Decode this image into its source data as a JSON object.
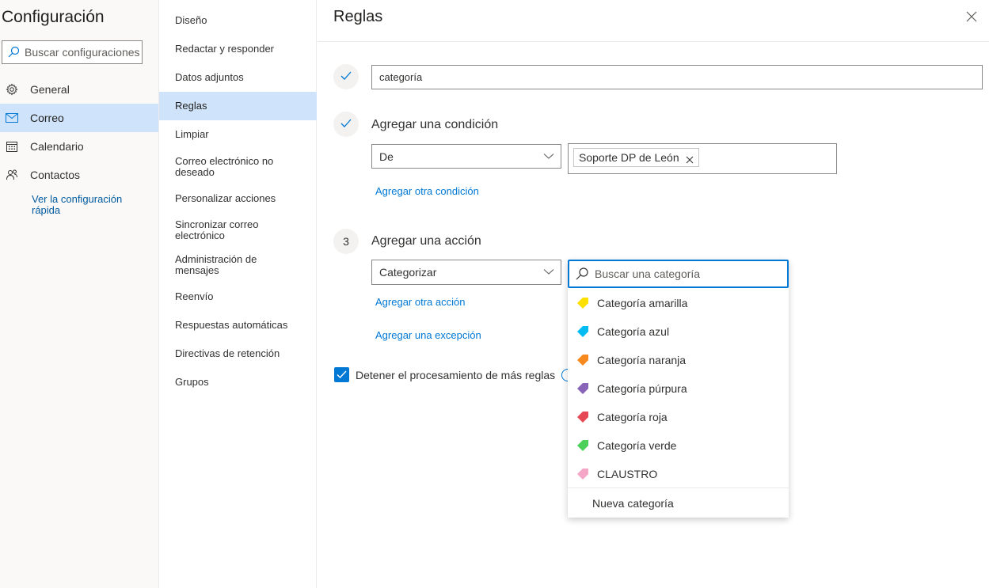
{
  "app": {
    "title": "Configuración",
    "search_placeholder": "Buscar configuraciones"
  },
  "left_nav": {
    "items": [
      {
        "label": "General",
        "icon": "gear-icon"
      },
      {
        "label": "Correo",
        "icon": "mail-icon"
      },
      {
        "label": "Calendario",
        "icon": "calendar-icon"
      },
      {
        "label": "Contactos",
        "icon": "people-icon"
      }
    ],
    "active_index": 1,
    "quick_link": "Ver la configuración rápida"
  },
  "mail_nav": {
    "items": [
      "Diseño",
      "Redactar y responder",
      "Datos adjuntos",
      "Reglas",
      "Limpiar",
      "Correo electrónico no deseado",
      "Personalizar acciones",
      "Sincronizar correo electrónico",
      "Administración de mensajes",
      "Reenvío",
      "Respuestas automáticas",
      "Directivas de retención",
      "Grupos"
    ],
    "active_index": 3
  },
  "panel": {
    "title": "Reglas",
    "rule_name": "categoría",
    "condition": {
      "title": "Agregar una condición",
      "type": "De",
      "value_chip": "Soporte DP de León",
      "add_link": "Agregar otra condición"
    },
    "action": {
      "step_number": "3",
      "title": "Agregar una acción",
      "type": "Categorizar",
      "search_placeholder": "Buscar una categoría",
      "add_link": "Agregar otra acción",
      "exception_link": "Agregar una excepción"
    },
    "stop_processing": {
      "label": "Detener el procesamiento de más reglas",
      "checked": true
    }
  },
  "categories": {
    "items": [
      {
        "label": "Categoría amarilla",
        "color": "#fce100"
      },
      {
        "label": "Categoría azul",
        "color": "#00bcf2"
      },
      {
        "label": "Categoría naranja",
        "color": "#f7891f"
      },
      {
        "label": "Categoría púrpura",
        "color": "#8764b8"
      },
      {
        "label": "Categoría roja",
        "color": "#e74856"
      },
      {
        "label": "Categoría verde",
        "color": "#4cd05a"
      },
      {
        "label": "CLAUSTRO",
        "color": "#f4a6c6"
      }
    ],
    "new_label": "Nueva categoría"
  },
  "colors": {
    "accent": "#0078d4",
    "selected_bg": "#cfe4fa"
  }
}
